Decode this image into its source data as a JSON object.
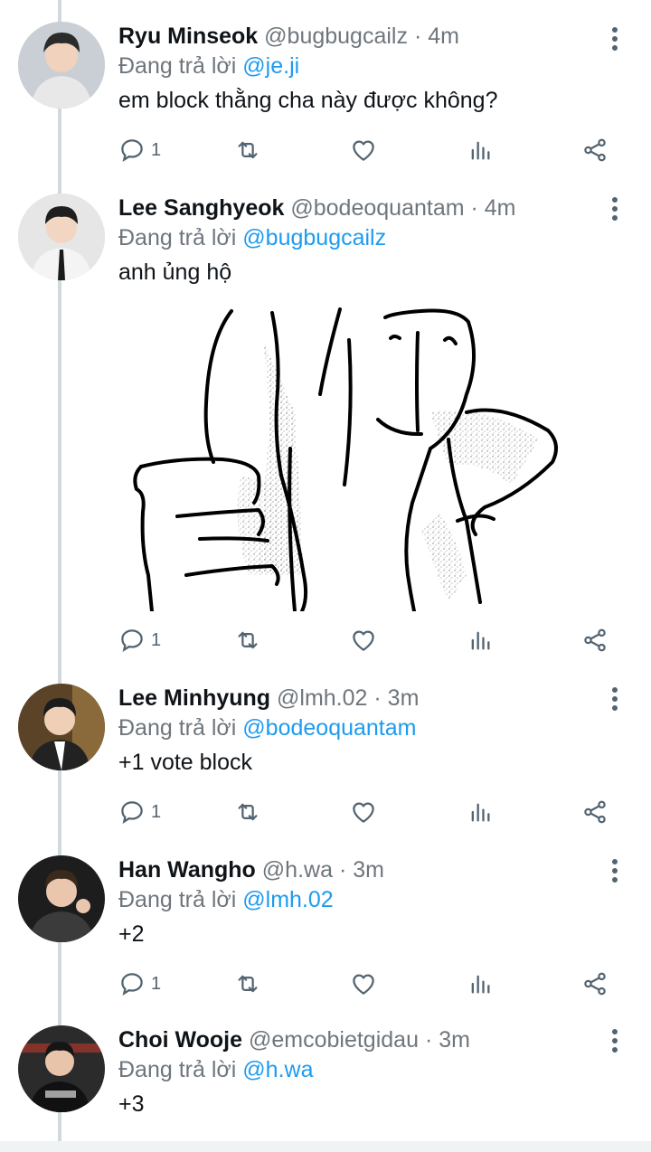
{
  "reply_prefix": "Đang trả lời",
  "tweets": [
    {
      "name": "Ryu Minseok",
      "handle": "@bugbugcailz",
      "time": "4m",
      "reply_to": "@je.ji",
      "text": "em block thằng cha này được không?",
      "reply_count": "1"
    },
    {
      "name": "Lee Sanghyeok",
      "handle": "@bodeoquantam",
      "time": "4m",
      "reply_to": "@bugbugcailz",
      "text": "anh ủng hộ",
      "reply_count": "1",
      "media": "thumbs-up-sketch"
    },
    {
      "name": "Lee Minhyung",
      "handle": "@lmh.02",
      "time": "3m",
      "reply_to": "@bodeoquantam",
      "text": "+1 vote block",
      "reply_count": "1"
    },
    {
      "name": "Han Wangho",
      "handle": "@h.wa",
      "time": "3m",
      "reply_to": "@lmh.02",
      "text": "+2",
      "reply_count": "1"
    },
    {
      "name": "Choi Wooje",
      "handle": "@emcobietgidau",
      "time": "3m",
      "reply_to": "@h.wa",
      "text": "+3"
    }
  ],
  "icons": {
    "reply": "comment-icon",
    "retweet": "retweet-icon",
    "like": "heart-icon",
    "views": "analytics-icon",
    "share": "share-icon",
    "more": "more-vertical-icon"
  },
  "colors": {
    "mention": "#1d9bf0",
    "muted": "#6e767d",
    "thread_line": "#cfd9de"
  }
}
